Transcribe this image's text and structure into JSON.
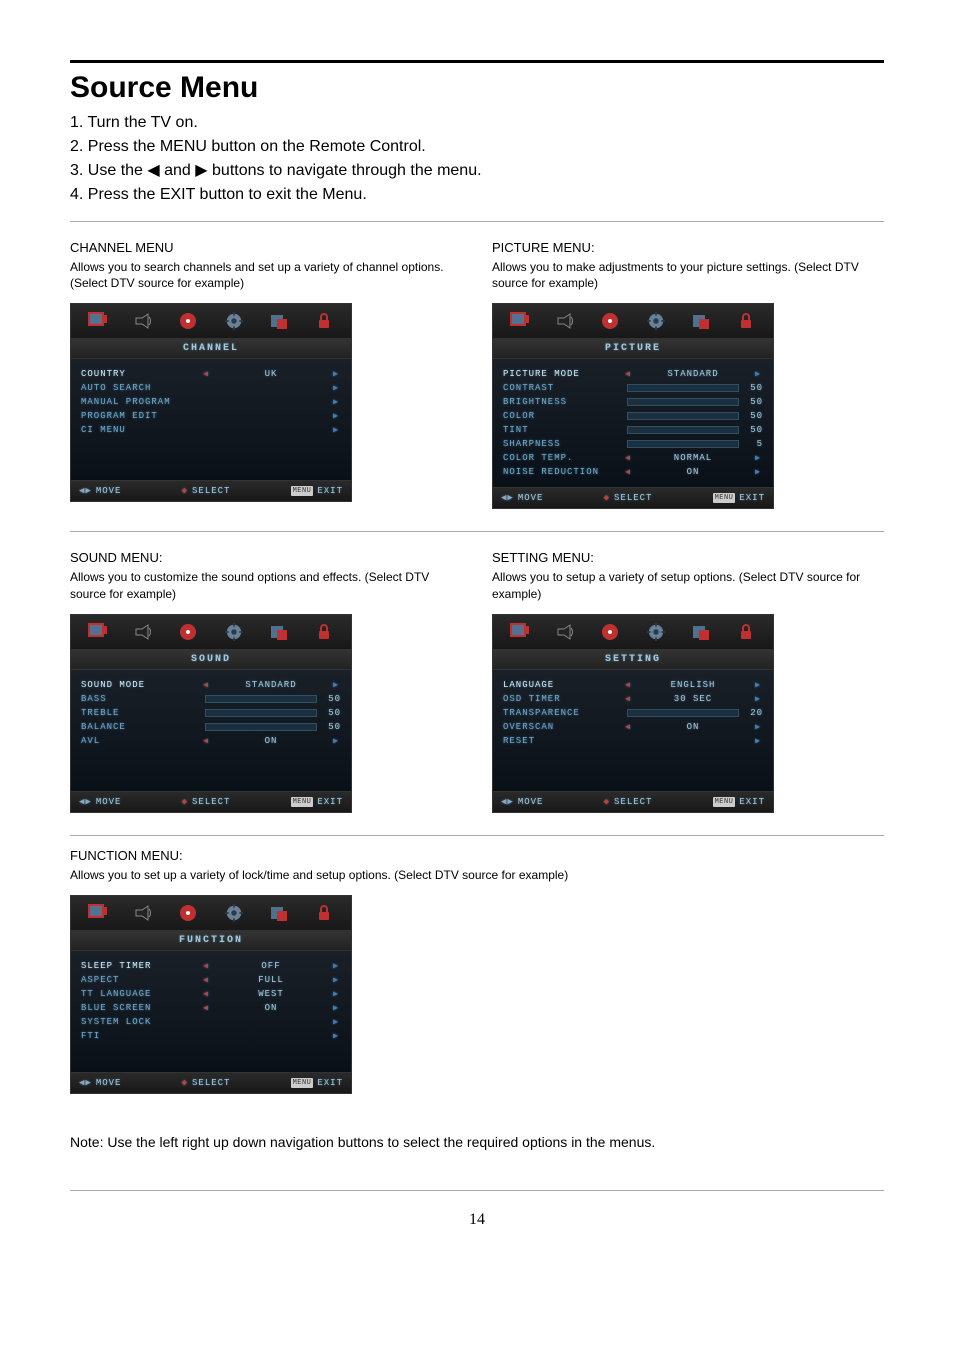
{
  "page_title": "Source Menu",
  "steps": [
    "1. Turn the TV on.",
    "2. Press the MENU button on the Remote Control.",
    "3. Use the ◀ and ▶ buttons to navigate through the menu.",
    "4. Press the EXIT button to exit the Menu."
  ],
  "footer_controls": {
    "move": "MOVE",
    "select": "SELECT",
    "exit_badge": "MENU",
    "exit": "EXIT"
  },
  "sections": {
    "channel": {
      "title": "CHANNEL MENU",
      "desc": "Allows you to search channels and set up a variety of channel options. (Select DTV source for example)",
      "header": "CHANNEL",
      "rows": [
        {
          "label": "COUNTRY",
          "type": "value",
          "value": "UK",
          "left": "red",
          "right": "blue",
          "selected": true
        },
        {
          "label": "AUTO SEARCH",
          "type": "nav",
          "right": "blue"
        },
        {
          "label": "MANUAL PROGRAM",
          "type": "nav",
          "right": "blue"
        },
        {
          "label": "PROGRAM EDIT",
          "type": "nav",
          "right": "blue"
        },
        {
          "label": "CI MENU",
          "type": "nav",
          "right": "blue"
        }
      ]
    },
    "picture": {
      "title": "PICTURE MENU:",
      "desc": "Allows you to make adjustments to your picture settings. (Select DTV source for example)",
      "header": "PICTURE",
      "rows": [
        {
          "label": "PICTURE MODE",
          "type": "value",
          "value": "STANDARD",
          "left": "red",
          "right": "blue",
          "selected": true
        },
        {
          "label": "CONTRAST",
          "type": "slider",
          "num": "50",
          "fill": 50
        },
        {
          "label": "BRIGHTNESS",
          "type": "slider",
          "num": "50",
          "fill": 50
        },
        {
          "label": "COLOR",
          "type": "slider",
          "num": "50",
          "fill": 50
        },
        {
          "label": "TINT",
          "type": "slider",
          "num": "50",
          "fill": 50
        },
        {
          "label": "SHARPNESS",
          "type": "slider",
          "num": "5",
          "fill": 50
        },
        {
          "label": "COLOR TEMP.",
          "type": "value",
          "value": "NORMAL",
          "left": "red",
          "right": "blue"
        },
        {
          "label": "NOISE REDUCTION",
          "type": "value",
          "value": "ON",
          "left": "red",
          "right": "blue"
        }
      ]
    },
    "sound": {
      "title": "SOUND MENU:",
      "desc": "Allows you to customize the sound options and effects. (Select DTV source for example)",
      "header": "SOUND",
      "rows": [
        {
          "label": "SOUND MODE",
          "type": "value",
          "value": "STANDARD",
          "left": "red",
          "right": "blue",
          "selected": true
        },
        {
          "label": "BASS",
          "type": "slider",
          "num": "50",
          "fill": 50
        },
        {
          "label": "TREBLE",
          "type": "slider",
          "num": "50",
          "fill": 50
        },
        {
          "label": "BALANCE",
          "type": "slider",
          "num": "50",
          "fill": 50
        },
        {
          "label": "AVL",
          "type": "value",
          "value": "ON",
          "left": "red",
          "right": "blue"
        }
      ]
    },
    "setting": {
      "title": "SETTING MENU:",
      "desc": "Allows you to setup a variety of setup options. (Select DTV source for example)",
      "header": "SETTING",
      "rows": [
        {
          "label": "LANGUAGE",
          "type": "value",
          "value": "ENGLISH",
          "left": "red",
          "right": "blue",
          "selected": true
        },
        {
          "label": "OSD TIMER",
          "type": "value",
          "value": "30 SEC",
          "left": "red",
          "right": "blue"
        },
        {
          "label": "TRANSPARENCE",
          "type": "slider",
          "num": "20",
          "fill": 20
        },
        {
          "label": "OVERSCAN",
          "type": "value",
          "value": "ON",
          "left": "red",
          "right": "blue"
        },
        {
          "label": "RESET",
          "type": "nav",
          "right": "blue"
        }
      ]
    },
    "function": {
      "title": "FUNCTION MENU:",
      "desc": "Allows you to set up a variety of lock/time and setup options. (Select DTV source for example)",
      "header": "FUNCTION",
      "rows": [
        {
          "label": "SLEEP TIMER",
          "type": "value",
          "value": "OFF",
          "left": "red",
          "right": "blue",
          "selected": true
        },
        {
          "label": "ASPECT",
          "type": "value",
          "value": "FULL",
          "left": "red",
          "right": "blue"
        },
        {
          "label": "TT LANGUAGE",
          "type": "value",
          "value": "WEST",
          "left": "red",
          "right": "blue"
        },
        {
          "label": "BLUE SCREEN",
          "type": "value",
          "value": "ON",
          "left": "red",
          "right": "blue"
        },
        {
          "label": "SYSTEM LOCK",
          "type": "nav",
          "right": "blue"
        },
        {
          "label": "FTI",
          "type": "nav",
          "right": "blue"
        }
      ]
    }
  },
  "note": "Note: Use the left right up down navigation buttons to select the required options in the menus.",
  "page_number": "14"
}
